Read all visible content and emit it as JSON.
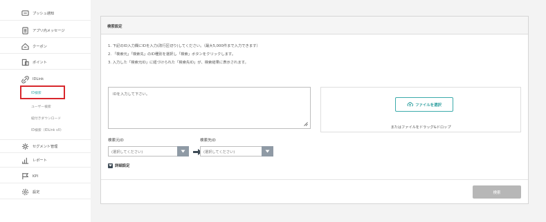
{
  "sidebar": {
    "items": [
      {
        "label": "プッシュ通知",
        "icon": "push-notification-icon"
      },
      {
        "label": "アプリ内メッセージ",
        "icon": "document-icon"
      },
      {
        "label": "クーポン",
        "icon": "coupon-icon"
      },
      {
        "label": "ポイント",
        "icon": "point-icon"
      },
      {
        "label": "IDLink",
        "icon": "link-icon"
      },
      {
        "label": "セグメント管理",
        "icon": "segment-icon"
      },
      {
        "label": "レポート",
        "icon": "chart-icon"
      },
      {
        "label": "KPI",
        "icon": "flag-icon"
      },
      {
        "label": "設定",
        "icon": "gear-icon"
      }
    ],
    "subitems": [
      {
        "label": "ID検索",
        "active": true
      },
      {
        "label": "ユーザー検索"
      },
      {
        "label": "紐付きダウンロード"
      },
      {
        "label": "ID検索（IDLink v0）"
      }
    ]
  },
  "panel": {
    "title": "検索設定",
    "instructions": [
      "1. 下記のID入力欄にIDを入力(改行区切り)してください。（最大5,000件まで入力できます）",
      "2. 「検索元」「検索先」のID種別を選択し「検索」ボタンをクリックします。",
      "3. 入力した「検索元ID」に紐づけられた「検索先ID」が、検索結果に表示されます。"
    ],
    "textarea_placeholder": "IDを入力して下さい。",
    "file_button": "ファイルを選択",
    "drop_hint": "またはファイルをドラッグ&ドロップ",
    "source_label": "検索元ID",
    "source_placeholder": "(選択してください)",
    "target_label": "検索先ID",
    "target_placeholder": "(選択してください)",
    "advanced_label": "詳細設定",
    "search_button": "検索"
  },
  "colors": {
    "accent": "#3aaaaa",
    "highlight": "#d8262b",
    "disabled_button": "#b7b7b7",
    "dropdown_caret": "#8f9aa5"
  }
}
